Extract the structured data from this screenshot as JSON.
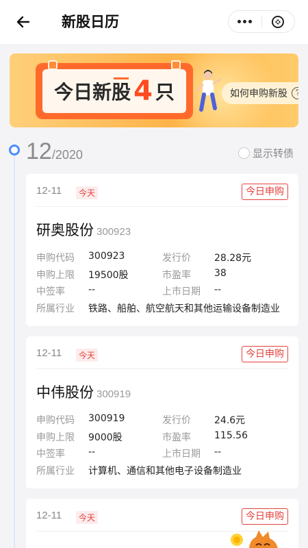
{
  "header": {
    "title": "新股日历"
  },
  "banner": {
    "text_prefix": "今日新股",
    "count": "4",
    "text_suffix": "只",
    "how_to_label": "如何申购新股",
    "help_glyph": "?"
  },
  "timeline": {
    "month": "12",
    "year": "/2020",
    "toggle_label": "显示转债"
  },
  "labels": {
    "code": "申购代码",
    "limit": "申购上限",
    "lottery": "中签率",
    "industry": "所属行业",
    "price": "发行价",
    "pe": "市盈率",
    "listing": "上市日期"
  },
  "cards": [
    {
      "date": "12-11",
      "today": "今天",
      "status": "今日申购",
      "name": "研奥股份",
      "code_small": "300923",
      "code": "300923",
      "price": "28.28元",
      "limit": "19500股",
      "pe": "38",
      "lottery": "--",
      "listing": "--",
      "industry": "铁路、船舶、航空航天和其他运输设备制造业"
    },
    {
      "date": "12-11",
      "today": "今天",
      "status": "今日申购",
      "name": "中伟股份",
      "code_small": "300919",
      "code": "300919",
      "price": "24.6元",
      "limit": "9000股",
      "pe": "115.56",
      "lottery": "--",
      "listing": "--",
      "industry": "计算机、通信和其他电子设备制造业"
    },
    {
      "date": "12-11",
      "today": "今天",
      "status": "今日申购"
    }
  ],
  "icons": {
    "back": "arrow-left-icon",
    "more": "more-dots-icon",
    "close": "close-circle-icon"
  },
  "colors": {
    "accent": "#e3403a",
    "timeline": "#4c8ef7",
    "banner": "#ffb44a"
  }
}
